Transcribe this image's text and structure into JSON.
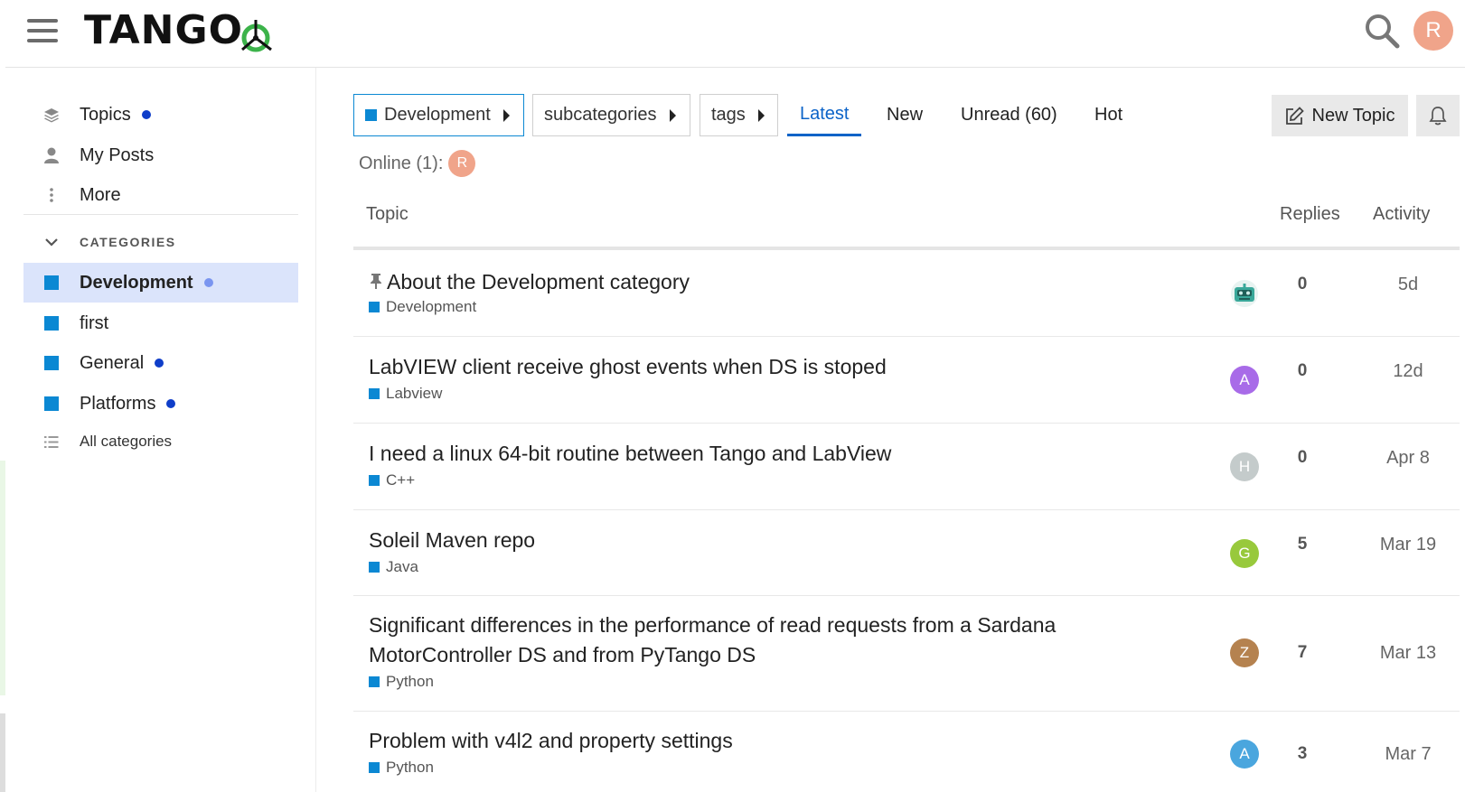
{
  "header": {
    "logo_text": "TANGO",
    "menu_icon": "hamburger-icon",
    "search_icon": "search-icon",
    "user_initial": "R",
    "user_color": "#f0a48a"
  },
  "sidebar": {
    "items": [
      {
        "label": "Topics",
        "icon": "layers-icon",
        "has_dot": true
      },
      {
        "label": "My Posts",
        "icon": "user-icon",
        "has_dot": false
      },
      {
        "label": "More",
        "icon": "vertical-ellipsis-icon",
        "has_dot": false
      }
    ],
    "categories_header": "CATEGORIES",
    "categories": [
      {
        "label": "Development",
        "active": true,
        "has_dot": true
      },
      {
        "label": "first",
        "active": false,
        "has_dot": false
      },
      {
        "label": "General",
        "active": false,
        "has_dot": true
      },
      {
        "label": "Platforms",
        "active": false,
        "has_dot": true
      }
    ],
    "all_categories": "All categories",
    "accent_color": "#0b88d3",
    "dot_color": "#0f3ec9"
  },
  "navigation": {
    "category_dropdown": "Development",
    "subcategories_dropdown": "subcategories",
    "tags_dropdown": "tags",
    "tabs": [
      "Latest",
      "New",
      "Unread (60)",
      "Hot"
    ],
    "active_tab": "Latest",
    "new_topic_label": "New Topic",
    "bell_icon": "bell-icon"
  },
  "online": {
    "label": "Online (1):",
    "user_initial": "R"
  },
  "table": {
    "headers": {
      "topic": "Topic",
      "replies": "Replies",
      "activity": "Activity"
    },
    "rows": [
      {
        "title": "About the Development category",
        "pinned": true,
        "category": "Development",
        "poster": "",
        "poster_color": "#3aa89a",
        "replies": "0",
        "activity": "5d"
      },
      {
        "title": "LabVIEW client receive ghost events when DS is stoped",
        "pinned": false,
        "category": "Labview",
        "poster": "A",
        "poster_color": "#a86be8",
        "replies": "0",
        "activity": "12d"
      },
      {
        "title": "I need a linux 64-bit routine between Tango and LabView",
        "pinned": false,
        "category": "C++",
        "poster": "H",
        "poster_color": "#c4cbcb",
        "replies": "0",
        "activity": "Apr 8"
      },
      {
        "title": "Soleil Maven repo",
        "pinned": false,
        "category": "Java",
        "poster": "G",
        "poster_color": "#98c93c",
        "replies": "5",
        "activity": "Mar 19"
      },
      {
        "title": "Significant differences in the performance of read requests from a Sardana MotorController DS and from PyTango DS",
        "pinned": false,
        "category": "Python",
        "poster": "Z",
        "poster_color": "#b5824f",
        "replies": "7",
        "activity": "Mar 13"
      },
      {
        "title": "Problem with v4l2 and property settings",
        "pinned": false,
        "category": "Python",
        "poster": "A",
        "poster_color": "#4aa6de",
        "replies": "3",
        "activity": "Mar 7"
      }
    ]
  }
}
